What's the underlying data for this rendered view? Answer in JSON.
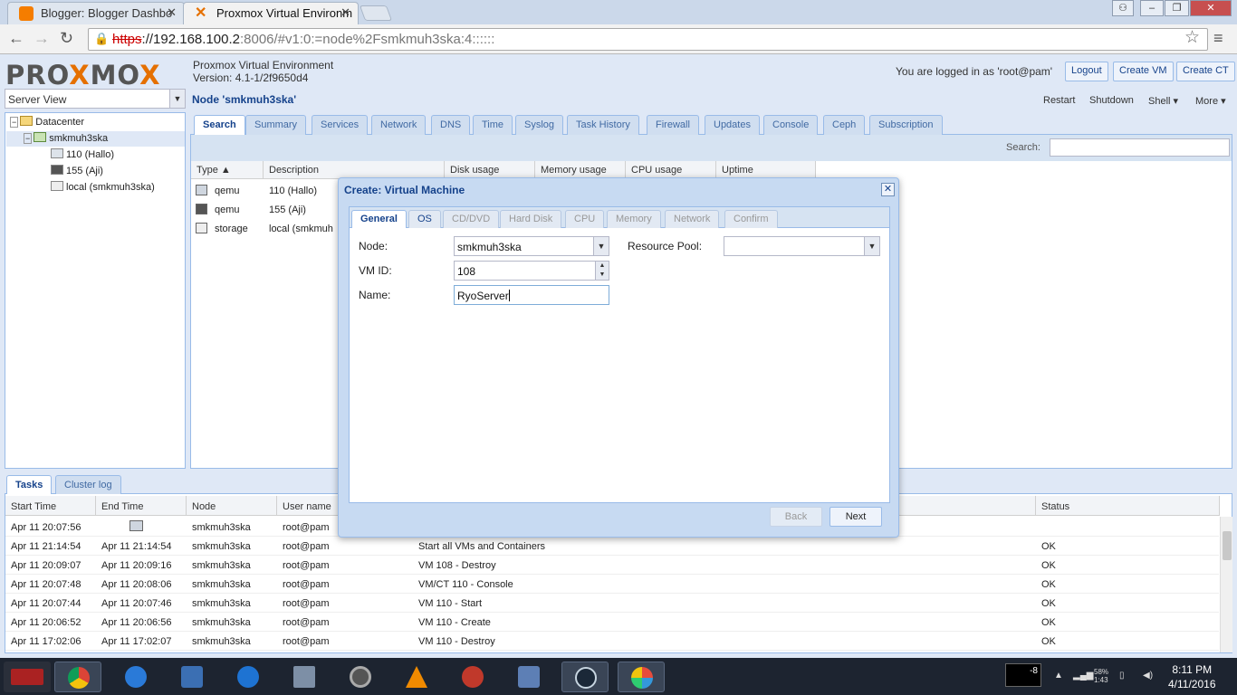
{
  "browser": {
    "tabs": [
      {
        "title": "Blogger: Blogger Dashbo",
        "favicon_color": "#f57d00"
      },
      {
        "title": "Proxmox Virtual Environm",
        "favicon_color": "#e57000"
      }
    ],
    "url": {
      "scheme": "https",
      "host": "://192.168.100.2",
      "rest": ":8006/#v1:0:=node%2Fsmkmuh3ska:4::::::"
    }
  },
  "header": {
    "logo_left": "PRO",
    "logo_x": "X",
    "logo_mid": "MO",
    "logo_x2": "X",
    "product": "Proxmox Virtual Environment",
    "version": "Version: 4.1-1/2f9650d4",
    "logged_in": "You are logged in as 'root@pam'",
    "logout": "Logout",
    "create_vm": "Create VM",
    "create_ct": "Create CT"
  },
  "sidebar": {
    "view": "Server View",
    "tree": [
      "Datacenter",
      "smkmuh3ska",
      "110 (Hallo)",
      "155 (Aji)",
      "local (smkmuh3ska)"
    ]
  },
  "node": {
    "title": "Node 'smkmuh3ska'",
    "actions": [
      "Restart",
      "Shutdown",
      "Shell ▾",
      "More ▾"
    ],
    "tabs": [
      "Search",
      "Summary",
      "Services",
      "Network",
      "DNS",
      "Time",
      "Syslog",
      "Task History",
      "Firewall",
      "Updates",
      "Console",
      "Ceph",
      "Subscription"
    ],
    "search_label": "Search:",
    "columns": [
      "Type ▲",
      "Description",
      "Disk usage",
      "Memory usage",
      "CPU usage",
      "Uptime"
    ],
    "rows": [
      {
        "type": "qemu",
        "desc": "110 (Hallo)"
      },
      {
        "type": "qemu",
        "desc": "155 (Aji)"
      },
      {
        "type": "storage",
        "desc": "local (smkmuh"
      }
    ]
  },
  "tasks": {
    "tabs": [
      "Tasks",
      "Cluster log"
    ],
    "columns": [
      "Start Time",
      "End Time",
      "Node",
      "User name",
      "Description",
      "Status"
    ],
    "rows": [
      {
        "start": "Apr 11 20:07:56",
        "end": "",
        "node": "smkmuh3ska",
        "user": "root@pam",
        "desc": "",
        "status": ""
      },
      {
        "start": "Apr 11 21:14:54",
        "end": "Apr 11 21:14:54",
        "node": "smkmuh3ska",
        "user": "root@pam",
        "desc": "Start all VMs and Containers",
        "status": "OK"
      },
      {
        "start": "Apr 11 20:09:07",
        "end": "Apr 11 20:09:16",
        "node": "smkmuh3ska",
        "user": "root@pam",
        "desc": "VM 108 - Destroy",
        "status": "OK"
      },
      {
        "start": "Apr 11 20:07:48",
        "end": "Apr 11 20:08:06",
        "node": "smkmuh3ska",
        "user": "root@pam",
        "desc": "VM/CT 110 - Console",
        "status": "OK"
      },
      {
        "start": "Apr 11 20:07:44",
        "end": "Apr 11 20:07:46",
        "node": "smkmuh3ska",
        "user": "root@pam",
        "desc": "VM 110 - Start",
        "status": "OK"
      },
      {
        "start": "Apr 11 20:06:52",
        "end": "Apr 11 20:06:56",
        "node": "smkmuh3ska",
        "user": "root@pam",
        "desc": "VM 110 - Create",
        "status": "OK"
      },
      {
        "start": "Apr 11 17:02:06",
        "end": "Apr 11 17:02:07",
        "node": "smkmuh3ska",
        "user": "root@pam",
        "desc": "VM 110 - Destroy",
        "status": "OK"
      }
    ]
  },
  "dialog": {
    "title": "Create: Virtual Machine",
    "tabs": [
      "General",
      "OS",
      "CD/DVD",
      "Hard Disk",
      "CPU",
      "Memory",
      "Network",
      "Confirm"
    ],
    "node_label": "Node:",
    "node_value": "smkmuh3ska",
    "vmid_label": "VM ID:",
    "vmid_value": "108",
    "name_label": "Name:",
    "name_value": "RyoServer",
    "pool_label": "Resource Pool:",
    "pool_value": "",
    "back": "Back",
    "next": "Next"
  },
  "taskbar": {
    "battery": "58%",
    "battery_time": "1:43",
    "badge": "-8",
    "time": "8:11 PM",
    "date": "4/11/2016"
  }
}
